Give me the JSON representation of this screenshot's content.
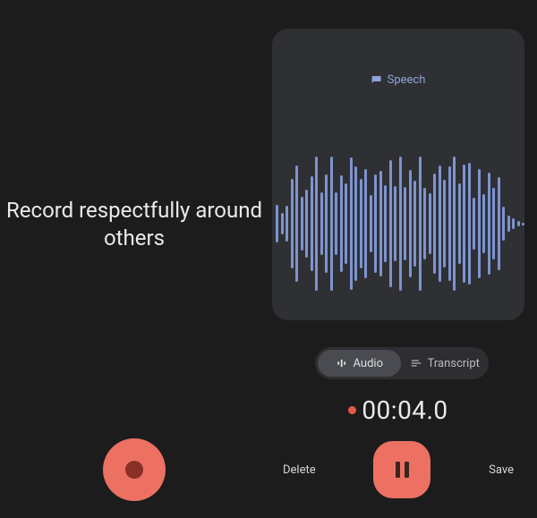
{
  "headline": "Record respectfully around others",
  "preview": {
    "tag_label": "Speech"
  },
  "tabs": {
    "audio": "Audio",
    "transcript": "Transcript"
  },
  "timer": "00:04.0",
  "controls": {
    "delete": "Delete",
    "save": "Save"
  },
  "colors": {
    "accent": "#ec7163",
    "wave": "#7e94cf"
  },
  "wave_heights": [
    42,
    24,
    40,
    100,
    130,
    60,
    76,
    106,
    150,
    70,
    110,
    150,
    70,
    108,
    90,
    148,
    128,
    100,
    122,
    64,
    110,
    118,
    86,
    142,
    84,
    150,
    82,
    120,
    96,
    150,
    80,
    68,
    112,
    130,
    98,
    128,
    150,
    90,
    132,
    136,
    58,
    122,
    66,
    114,
    80,
    104,
    38,
    18,
    12,
    6,
    3
  ]
}
